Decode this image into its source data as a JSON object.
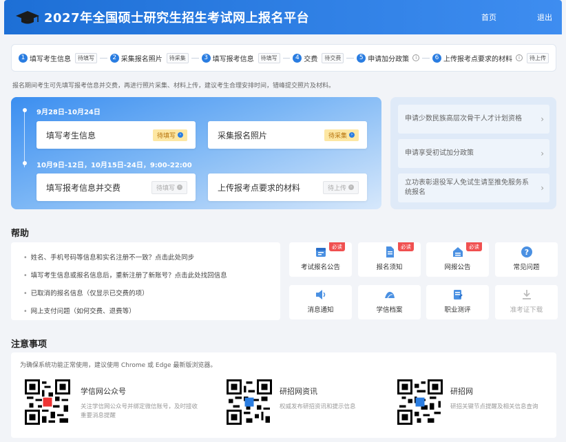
{
  "header": {
    "title": "2027年全国硕士研究生招生考试网上报名平台",
    "nav_home": "首页",
    "nav_logout": "退出"
  },
  "steps": [
    {
      "num": "1",
      "label": "填写考生信息",
      "status": "待填写",
      "info": false
    },
    {
      "num": "2",
      "label": "采集报名照片",
      "status": "待采集",
      "info": false
    },
    {
      "num": "3",
      "label": "填写报考信息",
      "status": "待填写",
      "info": false
    },
    {
      "num": "4",
      "label": "交费",
      "status": "待交费",
      "info": false
    },
    {
      "num": "5",
      "label": "申请加分政策",
      "status": "",
      "info": true
    },
    {
      "num": "6",
      "label": "上传报考点要求的材料",
      "status": "待上传",
      "info": true
    }
  ],
  "notice": "报名期间考生可先填写报考信息并交费，再进行照片采集、材料上传，建议考生合理安排时间，错峰提交照片及材料。",
  "schedule": {
    "period1": "9月28日-10月24日",
    "period2": "10月9日-12日，10月15日-24日，9:00-22:00",
    "cards": [
      {
        "label": "填写考生信息",
        "badge": "待填写",
        "active": true
      },
      {
        "label": "采集报名照片",
        "badge": "待采集",
        "active": true
      },
      {
        "label": "填写报考信息并交费",
        "badge": "待填写",
        "active": false
      },
      {
        "label": "上传报考点要求的材料",
        "badge": "待上传",
        "active": false
      }
    ]
  },
  "side": {
    "items": [
      "申请少数民族高层次骨干人才计划资格",
      "申请享受初试加分政策",
      "立功表彰退役军人免试生请至推免服务系统报名"
    ]
  },
  "help": {
    "title": "帮助",
    "links": [
      "姓名、手机号码等信息和实名注册不一致？点击此处同步",
      "填写考生信息或报名信息后，重新注册了新账号？点击此处找回信息",
      "已取消的报名信息（仅显示已交费的项）",
      "网上支付问题（如何交费、退费等）"
    ],
    "must_label": "必读",
    "tiles": [
      {
        "label": "考试报名公告",
        "icon": "calendar-icon",
        "must": true
      },
      {
        "label": "报名须知",
        "icon": "document-icon",
        "must": true
      },
      {
        "label": "网报公告",
        "icon": "notice-icon",
        "must": true
      },
      {
        "label": "常见问题",
        "icon": "question-icon",
        "must": false
      },
      {
        "label": "消息通知",
        "icon": "speaker-icon",
        "must": false
      },
      {
        "label": "学信档案",
        "icon": "archive-icon",
        "must": false
      },
      {
        "label": "职业测评",
        "icon": "assessment-icon",
        "must": false
      },
      {
        "label": "准考证下载",
        "icon": "download-icon",
        "must": false
      }
    ]
  },
  "notes": {
    "title": "注意事项",
    "tip": "为确保系统功能正常使用，建议使用 Chrome 或 Edge 最新版浏览器。",
    "qrs": [
      {
        "title": "学信网公众号",
        "desc": "关注学信网公众号并绑定微信账号，及时接收重要消息提醒"
      },
      {
        "title": "研招网资讯",
        "desc": "权威发布研招资讯和提示信息"
      },
      {
        "title": "研招网",
        "desc": "研招关键节点提醒及相关信息查询"
      }
    ]
  },
  "colors": {
    "primary": "#2a7de1",
    "must": "#f05050",
    "badge_active": "#fde7a3"
  }
}
